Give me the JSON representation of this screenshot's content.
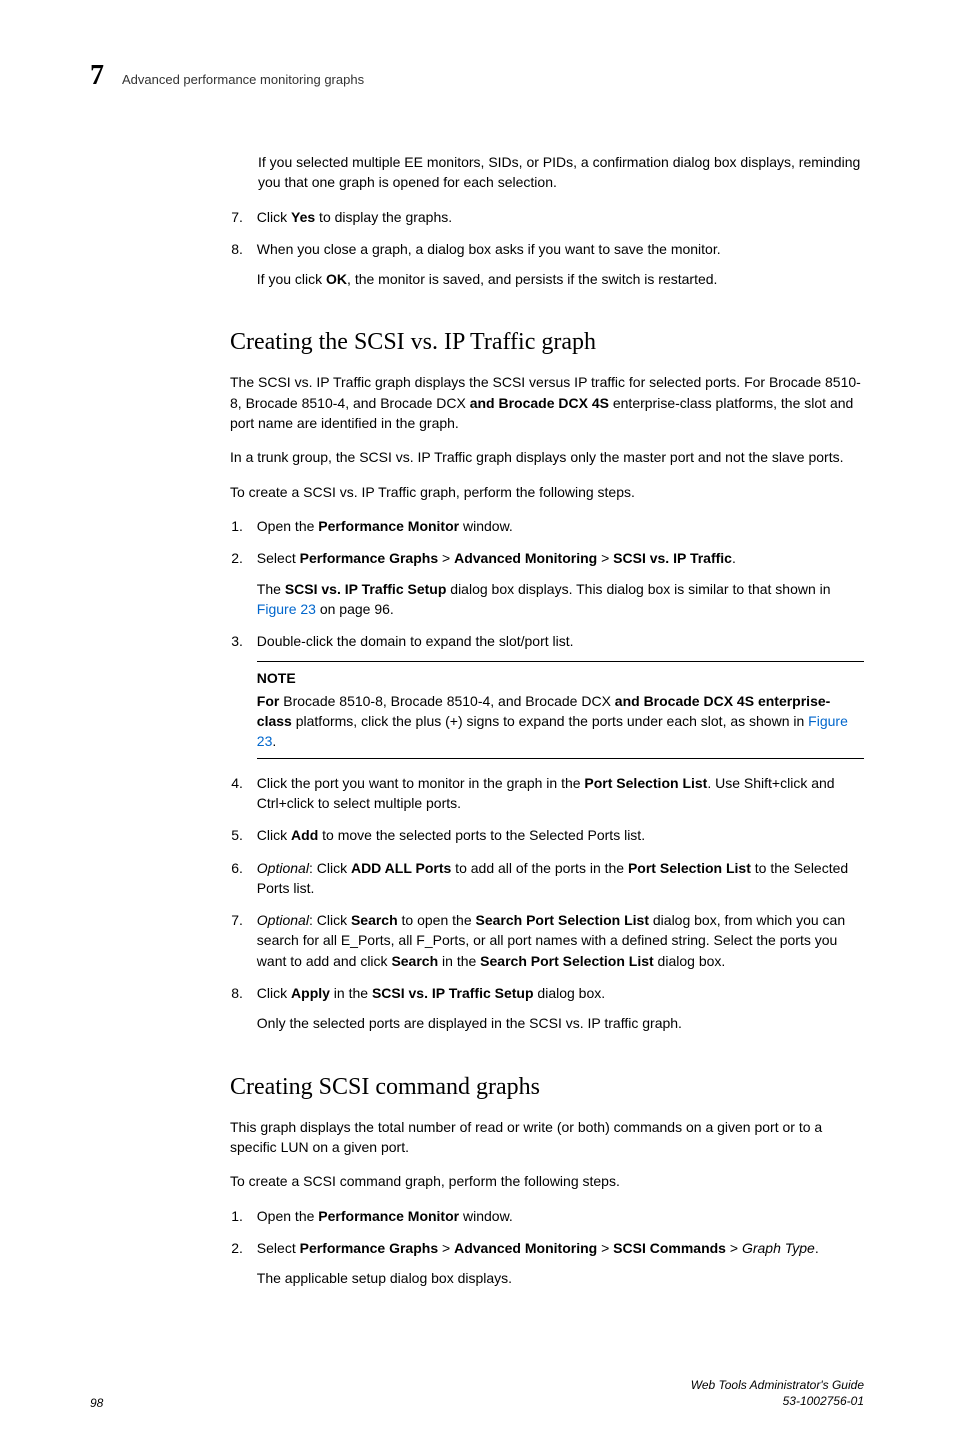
{
  "header": {
    "chapter_number": "7",
    "chapter_title": "Advanced performance monitoring graphs"
  },
  "intro_para": {
    "text": "If you selected multiple EE monitors, SIDs, or PIDs, a confirmation dialog box displays, reminding you that one graph is opened for each selection."
  },
  "steps_top": {
    "item7": {
      "prefix": "Click ",
      "bold1": "Yes",
      "suffix": " to display the graphs."
    },
    "item8": {
      "line1": "When you close a graph, a dialog box asks if you want to save the monitor.",
      "line2_prefix": "If you click ",
      "line2_bold": "OK",
      "line2_suffix": ", the monitor is saved, and persists if the switch is restarted."
    }
  },
  "section1": {
    "heading": "Creating the SCSI vs. IP Traffic graph",
    "p1_a": "The SCSI vs. IP Traffic graph displays the SCSI versus IP traffic for selected ports. For Brocade 8510-8, Brocade 8510-4, and Brocade DCX ",
    "p1_b": "and Brocade DCX 4S",
    "p1_c": " enterprise-class platforms, the slot and port name are identified in the graph.",
    "p2": "In a trunk group, the SCSI vs. IP Traffic graph displays only the master port and not the slave ports.",
    "p3": "To create a SCSI vs. IP Traffic graph, perform the following steps.",
    "steps": {
      "s1_a": "Open the ",
      "s1_b": "Performance Monitor",
      "s1_c": " window.",
      "s2_a": "Select ",
      "s2_b": "Performance Graphs",
      "s2_c": " > ",
      "s2_d": "Advanced Monitoring",
      "s2_e": " > ",
      "s2_f": "SCSI vs. IP Traffic",
      "s2_g": ".",
      "s2_sub_a": "The ",
      "s2_sub_b": "SCSI vs. IP Traffic Setup",
      "s2_sub_c": " dialog box displays. This dialog box is similar to that shown in ",
      "s2_sub_link": "Figure 23",
      "s2_sub_d": " on page 96.",
      "s3": "Double-click the domain to expand the slot/port list.",
      "note_label": "NOTE",
      "note_a": "For",
      "note_b": " Brocade 8510-8, Brocade 8510-4, and Brocade DCX ",
      "note_c": "and Brocade DCX 4S enterprise-class",
      "note_d": " platforms, click the plus (+) signs to expand the ports under each slot, as shown in ",
      "note_link": "Figure 23",
      "note_e": ".",
      "s4_a": "Click the port you want to monitor in the graph in the ",
      "s4_b": "Port Selection List",
      "s4_c": ". Use Shift+click and Ctrl+click to select multiple ports.",
      "s5_a": "Click ",
      "s5_b": "Add",
      "s5_c": " to move the selected ports to the Selected Ports list.",
      "s6_a": "Optional",
      "s6_b": ": Click ",
      "s6_c": "ADD ALL Ports",
      "s6_d": " to add all of the ports in the ",
      "s6_e": "Port Selection List",
      "s6_f": " to the Selected Ports list.",
      "s7_a": "Optional",
      "s7_b": ": Click ",
      "s7_c": "Search",
      "s7_d": " to open the ",
      "s7_e": "Search Port Selection List",
      "s7_f": " dialog box, from which you can search for all E_Ports, all F_Ports, or all port names with a defined string. Select the ports you want to add and click ",
      "s7_g": "Search",
      "s7_h": " in the ",
      "s7_i": "Search Port Selection List",
      "s7_j": " dialog box.",
      "s8_a": "Click ",
      "s8_b": "Apply",
      "s8_c": " in the ",
      "s8_d": "SCSI vs. IP Traffic Setup",
      "s8_e": " dialog box.",
      "s8_sub": "Only the selected ports are displayed in the SCSI vs. IP traffic graph."
    }
  },
  "section2": {
    "heading": "Creating SCSI command graphs",
    "p1": "This graph displays the total number of read or write (or both) commands on a given port or to a specific LUN on a given port.",
    "p2": "To create a SCSI command graph, perform the following steps.",
    "steps": {
      "s1_a": "Open the ",
      "s1_b": "Performance Monitor",
      "s1_c": " window.",
      "s2_a": "Select ",
      "s2_b": "Performance Graphs",
      "s2_c": " > ",
      "s2_d": "Advanced Monitoring",
      "s2_e": " > ",
      "s2_f": "SCSI Commands",
      "s2_g": " > ",
      "s2_h": "Graph Type",
      "s2_i": ".",
      "s2_sub": "The applicable setup dialog box displays."
    }
  },
  "footer": {
    "page_number": "98",
    "doc_title": "Web Tools Administrator's Guide",
    "doc_id": "53-1002756-01"
  }
}
